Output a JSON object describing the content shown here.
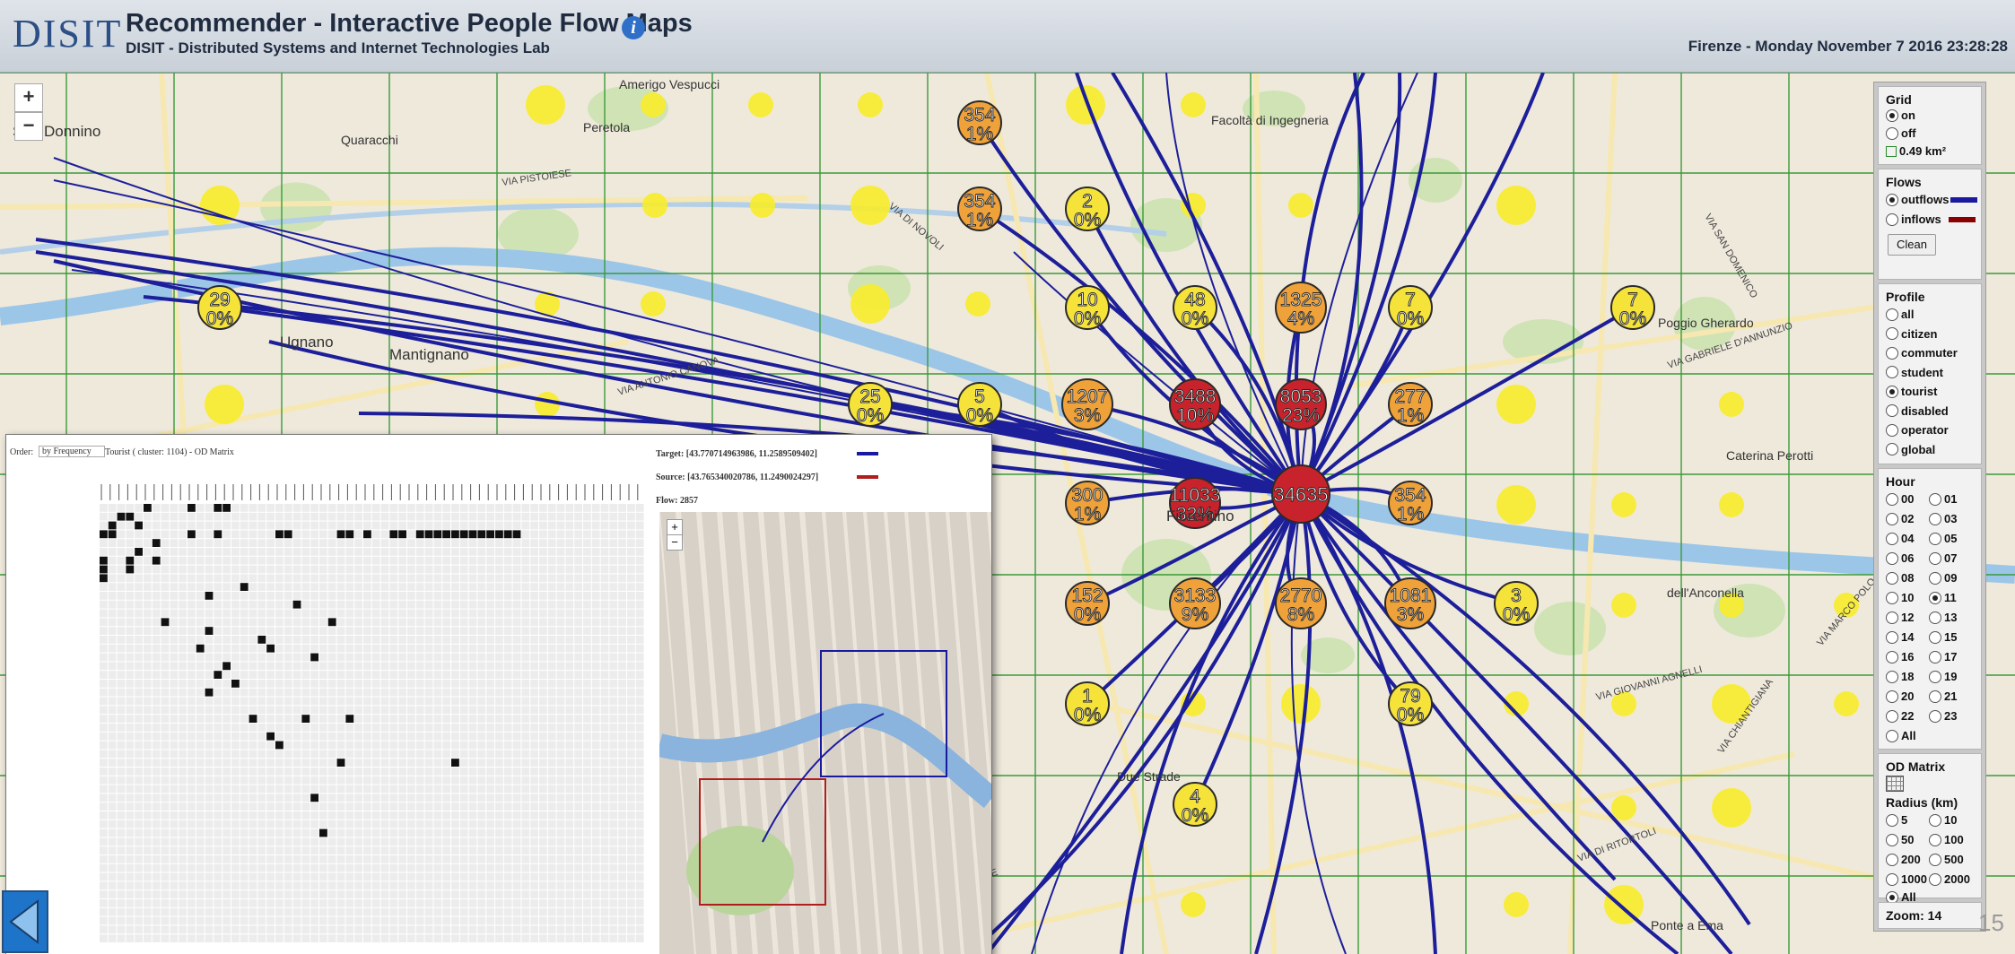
{
  "header": {
    "logo_text": "DISIT",
    "title": "Recommender - Interactive People Flow Maps",
    "subtitle": "DISIT - Distributed Systems and Internet Technologies Lab",
    "datetime": "Firenze - Monday November 7 2016 23:28:28",
    "info_icon": "info-icon"
  },
  "map": {
    "zoom_in": "+",
    "zoom_out": "−",
    "place_labels": [
      "San Donnino",
      "Ugnano",
      "Mantignano",
      "Peretola",
      "Quaracchi",
      "Amerigo Vespucci",
      "Facoltà di Ingegneria",
      "Poggio Gherardo",
      "Caterina Perotti",
      "dell'Anconella",
      "Due Strade",
      "Ponte a Ema",
      "Fiorentino"
    ],
    "street_labels": [
      "VIA PISTOIESE",
      "VIA DI NOVOLI",
      "VIA ANTONIO CANOVA",
      "VIA GABRIELE D'ANNUNZIO",
      "VIA SAN DOMENICO",
      "VIA DELLE CINQUE VIE",
      "VIA DI RITORTOLI",
      "VIA GIOVANNI AGNELLI",
      "VIA MARCO POLO",
      "VIA CHIANTIGIANA"
    ],
    "center_node": {
      "count": "34635",
      "pct": ""
    },
    "nodes": [
      {
        "count": "354",
        "pct": "1%"
      },
      {
        "count": "354",
        "pct": "1%"
      },
      {
        "count": "2",
        "pct": "0%"
      },
      {
        "count": "29",
        "pct": "0%"
      },
      {
        "count": "10",
        "pct": "0%"
      },
      {
        "count": "48",
        "pct": "0%"
      },
      {
        "count": "1325",
        "pct": "4%"
      },
      {
        "count": "7",
        "pct": "0%"
      },
      {
        "count": "7",
        "pct": "0%"
      },
      {
        "count": "25",
        "pct": "0%"
      },
      {
        "count": "5",
        "pct": "0%"
      },
      {
        "count": "1207",
        "pct": "3%"
      },
      {
        "count": "3488",
        "pct": "10%"
      },
      {
        "count": "8053",
        "pct": "23%"
      },
      {
        "count": "277",
        "pct": "1%"
      },
      {
        "count": "300",
        "pct": "1%"
      },
      {
        "count": "11033",
        "pct": "32%"
      },
      {
        "count": "354",
        "pct": "1%"
      },
      {
        "count": "152",
        "pct": "0%"
      },
      {
        "count": "3133",
        "pct": "9%"
      },
      {
        "count": "2770",
        "pct": "8%"
      },
      {
        "count": "1081",
        "pct": "3%"
      },
      {
        "count": "3",
        "pct": "0%"
      },
      {
        "count": "1",
        "pct": "0%"
      },
      {
        "count": "79",
        "pct": "0%"
      },
      {
        "count": "4",
        "pct": "0%"
      }
    ]
  },
  "panel": {
    "grid": {
      "title": "Grid",
      "on": "on",
      "off": "off",
      "cell": "0.49 km²",
      "selected": "on"
    },
    "flows": {
      "title": "Flows",
      "outflows": "outflows",
      "inflows": "inflows",
      "clean": "Clean",
      "selected": "outflows"
    },
    "profile": {
      "title": "Profile",
      "options": [
        "all",
        "citizen",
        "commuter",
        "student",
        "tourist",
        "disabled",
        "operator",
        "global"
      ],
      "selected": "tourist"
    },
    "hour": {
      "title": "Hour",
      "options": [
        "00",
        "01",
        "02",
        "03",
        "04",
        "05",
        "06",
        "07",
        "08",
        "09",
        "10",
        "11",
        "12",
        "13",
        "14",
        "15",
        "16",
        "17",
        "18",
        "19",
        "20",
        "21",
        "22",
        "23",
        "All"
      ],
      "selected": "11"
    },
    "od_matrix": {
      "title": "OD Matrix",
      "icon": "grid-icon"
    },
    "radius": {
      "title": "Radius (km)",
      "options": [
        "5",
        "10",
        "50",
        "100",
        "200",
        "500",
        "1000",
        "2000",
        "All"
      ],
      "selected": "All"
    },
    "zoom": "Zoom: 14"
  },
  "od_window": {
    "order_label": "Order:",
    "order_value": "by Frequency",
    "title": "Tourist ( cluster: 1104) - OD Matrix",
    "target": "Target: [43.770714963986, 11.2589509402] ",
    "source": "Source: [43.765340020786, 11.2490024297] ",
    "flow": "Flow: 2857",
    "target_color": "#1a1a9e",
    "source_color": "#b01d1d",
    "zoom_in": "+",
    "zoom_out": "−"
  },
  "footer": {
    "back_icon": "back-arrow-icon",
    "page_number": "15"
  }
}
